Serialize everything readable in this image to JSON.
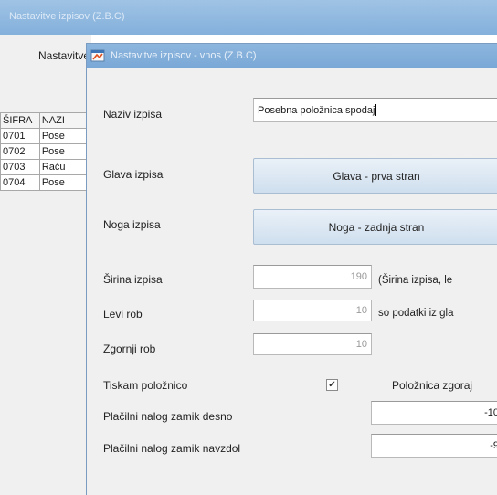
{
  "background_window": {
    "title": "Nastavitve izpisov (Z.B.C)",
    "heading": "Nastavitve",
    "table": {
      "headers": [
        "ŠIFRA",
        "NAZI"
      ],
      "rows": [
        [
          "0701",
          "Pose"
        ],
        [
          "0702",
          "Pose"
        ],
        [
          "0703",
          "Raču"
        ],
        [
          "0704",
          "Pose"
        ]
      ]
    }
  },
  "dialog": {
    "title": "Nastavitve izpisov - vnos (Z.B.C)",
    "name_label": "Naziv izpisa",
    "name_value": "Posebna položnica spodaj",
    "header_label": "Glava izpisa",
    "header_button": "Glava - prva stran",
    "footer_label": "Noga izpisa",
    "footer_button": "Noga - zadnja stran",
    "width_label": "Širina izpisa",
    "width_value": "190",
    "width_hint": "(Širina izpisa, le",
    "left_margin_label": "Levi rob",
    "left_margin_value": "10",
    "left_margin_hint": "so podatki iz gla",
    "top_margin_label": "Zgornji rob",
    "top_margin_value": "10",
    "print_slip_label": "Tiskam položnico",
    "print_slip_checked": true,
    "slip_top_label": "Položnica zgoraj",
    "payment_offset_right_label": "Plačilni nalog zamik desno",
    "payment_offset_right_value": "-10",
    "payment_offset_down_label": "Plačilni nalog zamik navzdol",
    "payment_offset_down_value": "-9"
  },
  "icons": {
    "dialog_icon": "app-window-icon",
    "checkbox_check": "check-icon"
  },
  "colors": {
    "titlebar": "#84b0dc",
    "button_top": "#eaf1f8",
    "button_bottom": "#cfdfee"
  }
}
